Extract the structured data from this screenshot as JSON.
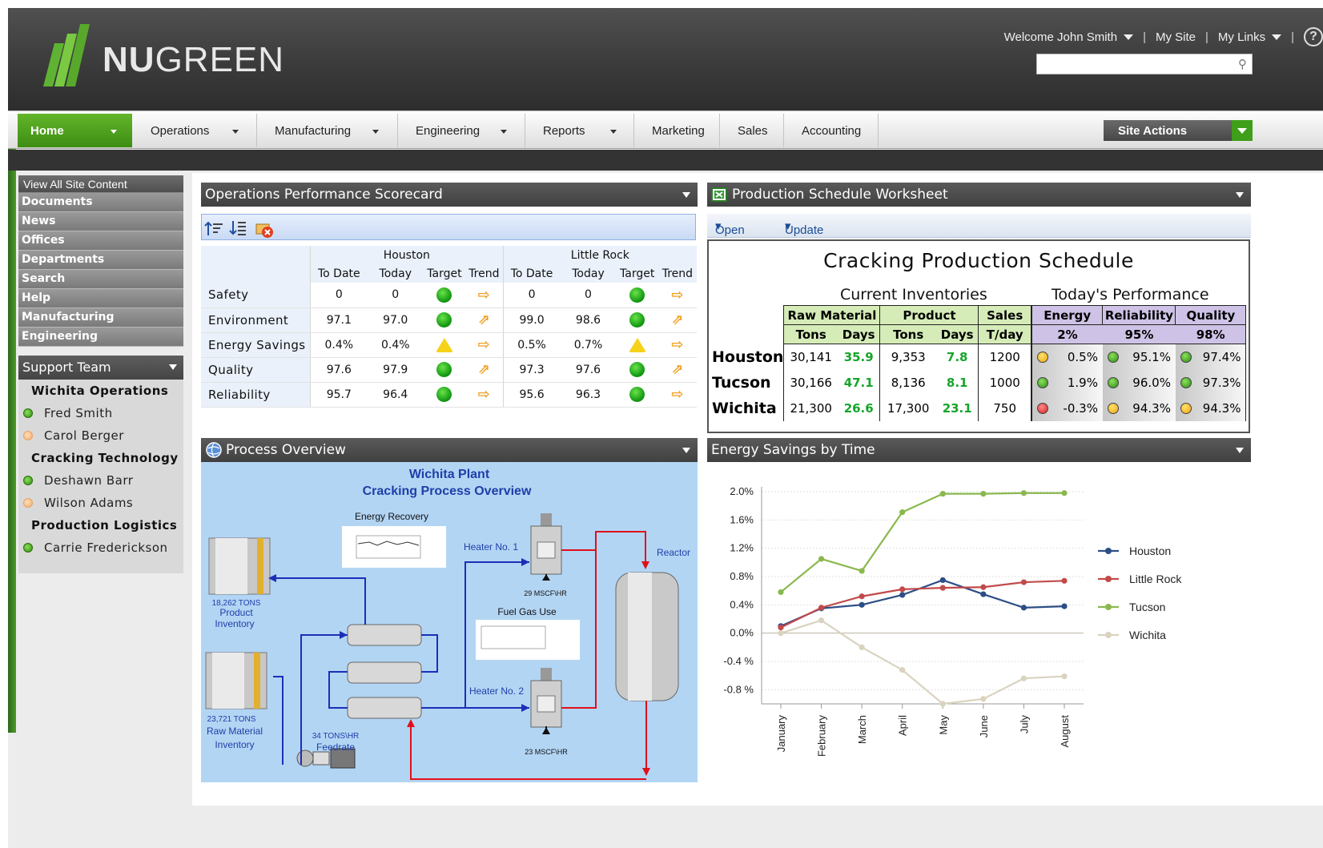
{
  "brand": {
    "name_bold": "NU",
    "name_light": "GREEN"
  },
  "toplinks": {
    "welcome": "Welcome John Smith",
    "my_site": "My Site",
    "my_links": "My Links",
    "help": "?"
  },
  "search": {
    "placeholder": ""
  },
  "nav": {
    "items": [
      "Home",
      "Operations",
      "Manufacturing",
      "Engineering",
      "Reports",
      "Marketing",
      "Sales",
      "Accounting"
    ],
    "site_actions": "Site Actions"
  },
  "quicklaunch": {
    "view_all": "View All Site Content",
    "items": [
      "Documents",
      "News",
      "Offices",
      "Departments",
      "Search",
      "Help",
      "Manufacturing",
      "Engineering"
    ]
  },
  "support_team": {
    "title": "Support Team",
    "teams": [
      {
        "name": "Wichita Operations",
        "members": [
          {
            "name": "Fred Smith",
            "status": "online"
          },
          {
            "name": "Carol Berger",
            "status": "away"
          }
        ]
      },
      {
        "name": "Cracking Technology",
        "members": [
          {
            "name": "Deshawn Barr",
            "status": "online"
          },
          {
            "name": "Wilson Adams",
            "status": "away"
          }
        ]
      },
      {
        "name": "Production Logistics",
        "members": [
          {
            "name": "Carrie Frederickson",
            "status": "online"
          }
        ]
      }
    ]
  },
  "scorecard": {
    "title": "Operations Performance Scorecard",
    "groups": [
      "Houston",
      "Little Rock"
    ],
    "columns": [
      "To Date",
      "Today",
      "Target",
      "Trend",
      "To Date",
      "Today",
      "Target",
      "Trend"
    ],
    "rows": [
      {
        "label": "Safety",
        "h_todate": "0",
        "h_today": "0",
        "h_target": "green",
        "h_trend": "flat",
        "l_todate": "0",
        "l_today": "0",
        "l_target": "green",
        "l_trend": "flat"
      },
      {
        "label": "Environment",
        "h_todate": "97.1",
        "h_today": "97.0",
        "h_target": "green",
        "h_trend": "up",
        "l_todate": "99.0",
        "l_today": "98.6",
        "l_target": "green",
        "l_trend": "up"
      },
      {
        "label": "Energy Savings",
        "h_todate": "0.4%",
        "h_today": "0.4%",
        "h_target": "yellow",
        "h_trend": "flat",
        "l_todate": "0.5%",
        "l_today": "0.7%",
        "l_target": "yellow",
        "l_trend": "flat"
      },
      {
        "label": "Quality",
        "h_todate": "97.6",
        "h_today": "97.9",
        "h_target": "green",
        "h_trend": "up",
        "l_todate": "97.3",
        "l_today": "97.6",
        "l_target": "green",
        "l_trend": "up"
      },
      {
        "label": "Reliability",
        "h_todate": "95.7",
        "h_today": "96.4",
        "h_target": "green",
        "h_trend": "flat",
        "l_todate": "95.6",
        "l_today": "96.3",
        "l_target": "green",
        "l_trend": "flat"
      }
    ]
  },
  "schedule": {
    "panel_title": "Production Schedule Worksheet",
    "menu": {
      "open": "Open",
      "update": "Update"
    },
    "title": "Cracking Production Schedule",
    "inventories_label": "Current Inventories",
    "performance_label": "Today's Performance",
    "headers": {
      "raw_material": "Raw Material",
      "product": "Product",
      "sales": "Sales",
      "energy": "Energy",
      "reliability": "Reliability",
      "quality": "Quality"
    },
    "subheaders": {
      "tons": "Tons",
      "days": "Days",
      "tday": "T/day",
      "energy_target": "2%",
      "reliability_target": "95%",
      "quality_target": "98%"
    },
    "rows": [
      {
        "city": "Houston",
        "raw_tons": "30,141",
        "raw_days": "35.9",
        "prod_tons": "9,353",
        "prod_days": "7.8",
        "sales": "1200",
        "energy": "0.5%",
        "energy_status": "orange",
        "reliability": "95.1%",
        "reliability_status": "green",
        "quality": "97.4%",
        "quality_status": "green"
      },
      {
        "city": "Tucson",
        "raw_tons": "30,166",
        "raw_days": "47.1",
        "prod_tons": "8,136",
        "prod_days": "8.1",
        "sales": "1000",
        "energy": "1.9%",
        "energy_status": "green",
        "reliability": "96.0%",
        "reliability_status": "green",
        "quality": "97.3%",
        "quality_status": "green"
      },
      {
        "city": "Wichita",
        "raw_tons": "21,300",
        "raw_days": "26.6",
        "prod_tons": "17,300",
        "prod_days": "23.1",
        "sales": "750",
        "energy": "-0.3%",
        "energy_status": "red",
        "reliability": "94.3%",
        "reliability_status": "orange",
        "quality": "94.3%",
        "quality_status": "orange"
      }
    ]
  },
  "process": {
    "panel_title": "Process Overview",
    "title1": "Wichita Plant",
    "title2": "Cracking Process Overview",
    "energy_recovery": "Energy Recovery",
    "heater1": "Heater No. 1",
    "heater2": "Heater No. 2",
    "reactor": "Reactor",
    "fuel_gas": "Fuel Gas Use",
    "heater1_flow": "29 MSCF\\HR",
    "heater2_flow": "23 MSCF\\HR",
    "product_inv_1": "18,262 TONS",
    "product_inv_2": "Product",
    "product_inv_3": "Inventory",
    "raw_inv_1": "23,721 TONS",
    "raw_inv_2": "Raw Material",
    "raw_inv_3": "Inventory",
    "feed_1": "34 TONS\\HR",
    "feed_2": "Feedrate"
  },
  "energy_chart": {
    "panel_title": "Energy Savings by Time"
  },
  "chart_data": {
    "type": "line",
    "title": "",
    "categories": [
      "January",
      "February",
      "March",
      "April",
      "May",
      "June",
      "July",
      "August"
    ],
    "yticks": [
      "2.0%",
      "1.6%",
      "1.2%",
      "0.8%",
      "0.4%",
      "0.0%",
      "-0.4 %",
      "-0.8 %"
    ],
    "ylim": [
      -1.0,
      2.0
    ],
    "legend_position": "right",
    "series": [
      {
        "name": "Houston",
        "color": "#2d4e86",
        "values": [
          0.1,
          0.35,
          0.4,
          0.54,
          0.75,
          0.55,
          0.36,
          0.38
        ]
      },
      {
        "name": "Little Rock",
        "color": "#c24a4a",
        "values": [
          0.08,
          0.36,
          0.52,
          0.62,
          0.64,
          0.65,
          0.72,
          0.74
        ]
      },
      {
        "name": "Tucson",
        "color": "#8ab84e",
        "values": [
          0.58,
          1.05,
          0.88,
          1.71,
          1.97,
          1.97,
          1.98,
          1.98
        ]
      },
      {
        "name": "Wichita",
        "color": "#d9d3bf",
        "values": [
          0.0,
          0.18,
          -0.2,
          -0.52,
          -1.0,
          -0.93,
          -0.64,
          -0.61
        ]
      }
    ]
  }
}
